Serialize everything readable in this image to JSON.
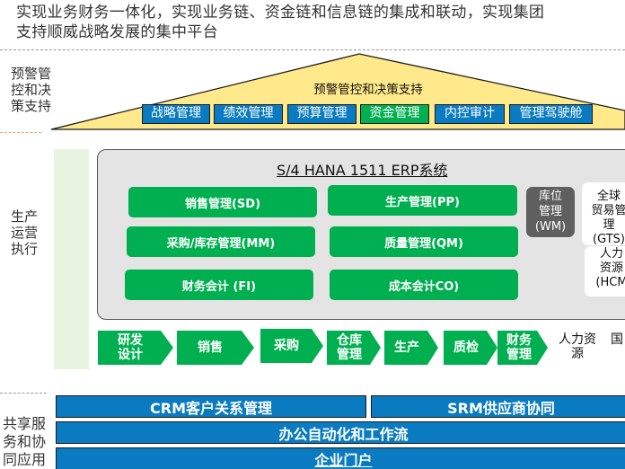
{
  "headline": {
    "line1": "实现业务财务一体化，实现业务链、资金链和信息链的集成和联动，实现集团",
    "line2": "支持顺威战略发展的集中平台"
  },
  "sections": {
    "decision": "预警管\n控和决\n策支持",
    "production": "生产\n运营\n执行",
    "shared": "共享服\n务和协\n同应用"
  },
  "roof": {
    "title": "预警管控和决策支持",
    "tabs": [
      {
        "label": "战略管理",
        "color": "#0a7bc0"
      },
      {
        "label": "绩效管理",
        "color": "#0a7bc0"
      },
      {
        "label": "预算管理",
        "color": "#0a7bc0"
      },
      {
        "label": "资金管理",
        "color": "#00b050"
      },
      {
        "label": "内控审计",
        "color": "#0a7bc0"
      },
      {
        "label": "管理驾驶舱",
        "color": "#0a7bc0"
      }
    ],
    "fill_color": "#ffe98a"
  },
  "erp": {
    "title": "S/4 HANA 1511 ERP系统",
    "modules": [
      {
        "label": "销售管理(SD)"
      },
      {
        "label": "生产管理(PP)"
      },
      {
        "label": "采购/库存管理(MM)"
      },
      {
        "label": "质量管理(QM)"
      },
      {
        "label": "财务会计 (FI)"
      },
      {
        "label": "成本会计CO)"
      }
    ],
    "wm": "库位\n管理\n(WM)",
    "gts": "全球\n贸易管\n理\n(GTS)",
    "hcm": "人力\n资源\n(HCM",
    "module_color": "#00b050",
    "wm_color": "#5f5f5f"
  },
  "flow": {
    "steps": [
      {
        "label": "研发\n设计"
      },
      {
        "label": "销售"
      },
      {
        "label": "采购"
      },
      {
        "label": "仓库\n管理"
      },
      {
        "label": "生产"
      },
      {
        "label": "质检"
      },
      {
        "label": "财务\n管理"
      }
    ],
    "plain": [
      "人力资\n源",
      "国"
    ]
  },
  "shared": {
    "crm": "CRM客户关系管理",
    "srm": "SRM供应商协同",
    "oa": "办公自动化和工作流",
    "portal": "企业门户",
    "bar_color": "#0a7bc0"
  }
}
